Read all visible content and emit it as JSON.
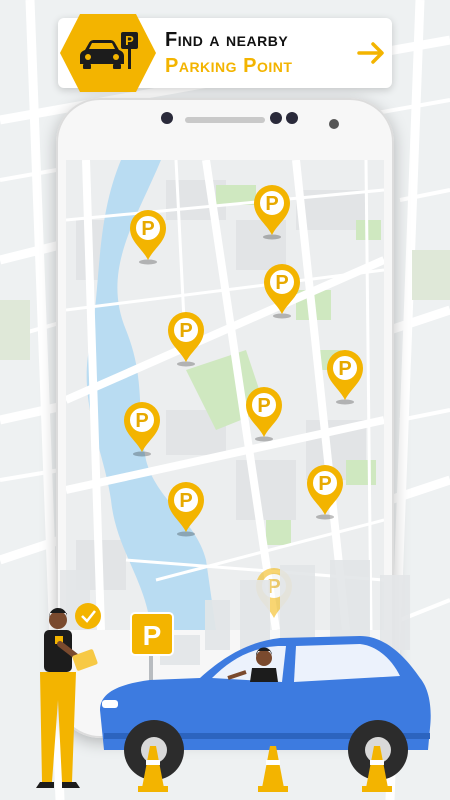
{
  "banner": {
    "title": "Find a nearby",
    "subtitle": "Parking Point",
    "icon": "car-parking-icon",
    "arrow_icon": "arrow-right-icon"
  },
  "pin_label": "P",
  "sign_label": "P",
  "colors": {
    "accent": "#f3b400",
    "water": "#b9dcf2",
    "park": "#cfe8c0",
    "car": "#3d7be0",
    "text_dark": "#111111"
  }
}
